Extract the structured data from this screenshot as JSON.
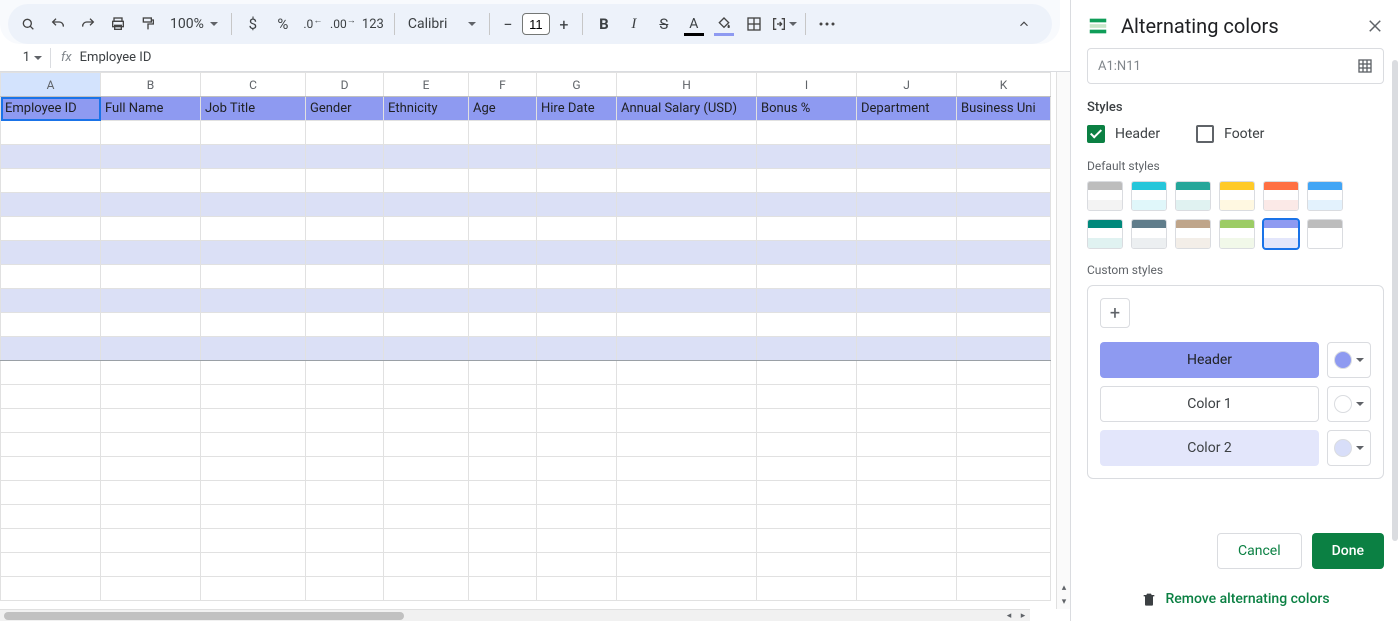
{
  "toolbar": {
    "zoom": "100%",
    "font_name": "Calibri",
    "font_size": "11"
  },
  "namebox": {
    "ref": "1"
  },
  "formula_bar": {
    "value": "Employee ID"
  },
  "columns": [
    "A",
    "B",
    "C",
    "D",
    "E",
    "F",
    "G",
    "H",
    "I",
    "J",
    "K"
  ],
  "headers": [
    "Employee ID",
    "Full Name",
    "Job Title",
    "Gender",
    "Ethnicity",
    "Age",
    "Hire Date",
    "Annual Salary (USD)",
    "Bonus %",
    "Department",
    "Business Uni"
  ],
  "panel": {
    "title": "Alternating colors",
    "range": "A1:N11",
    "styles_label": "Styles",
    "header_label": "Header",
    "footer_label": "Footer",
    "header_checked": true,
    "footer_checked": false,
    "default_styles_label": "Default styles",
    "custom_styles_label": "Custom styles",
    "rows": {
      "header": {
        "label": "Header",
        "bg": "#8e9af1",
        "swatch": "#8e9af1"
      },
      "color1": {
        "label": "Color 1",
        "bg": "#ffffff",
        "swatch": "#ffffff"
      },
      "color2": {
        "label": "Color 2",
        "bg": "#e3e6fb",
        "swatch": "#d8def9"
      }
    },
    "cancel": "Cancel",
    "done": "Done",
    "remove": "Remove alternating colors"
  },
  "default_swatches": [
    {
      "h": "#bdbdbd",
      "a": "#ffffff",
      "b": "#f3f3f3"
    },
    {
      "h": "#26c6da",
      "a": "#ffffff",
      "b": "#e0f7fa"
    },
    {
      "h": "#26a69a",
      "a": "#ffffff",
      "b": "#e0f2f1"
    },
    {
      "h": "#ffca28",
      "a": "#ffffff",
      "b": "#fff8e1"
    },
    {
      "h": "#ff7043",
      "a": "#ffffff",
      "b": "#fbe9e7"
    },
    {
      "h": "#42a5f5",
      "a": "#ffffff",
      "b": "#e3f2fd"
    },
    {
      "h": "#00897b",
      "a": "#ffffff",
      "b": "#e0f2f1"
    },
    {
      "h": "#607d8b",
      "a": "#ffffff",
      "b": "#eceff1"
    },
    {
      "h": "#bfa58a",
      "a": "#ffffff",
      "b": "#f3eee8"
    },
    {
      "h": "#9ccc65",
      "a": "#ffffff",
      "b": "#f1f8e9"
    },
    {
      "h": "#8e9af1",
      "a": "#ffffff",
      "b": "#e3e6fb",
      "sel": true
    },
    {
      "h": "#bdbdbd",
      "a": "#ffffff",
      "b": "#ffffff"
    }
  ]
}
